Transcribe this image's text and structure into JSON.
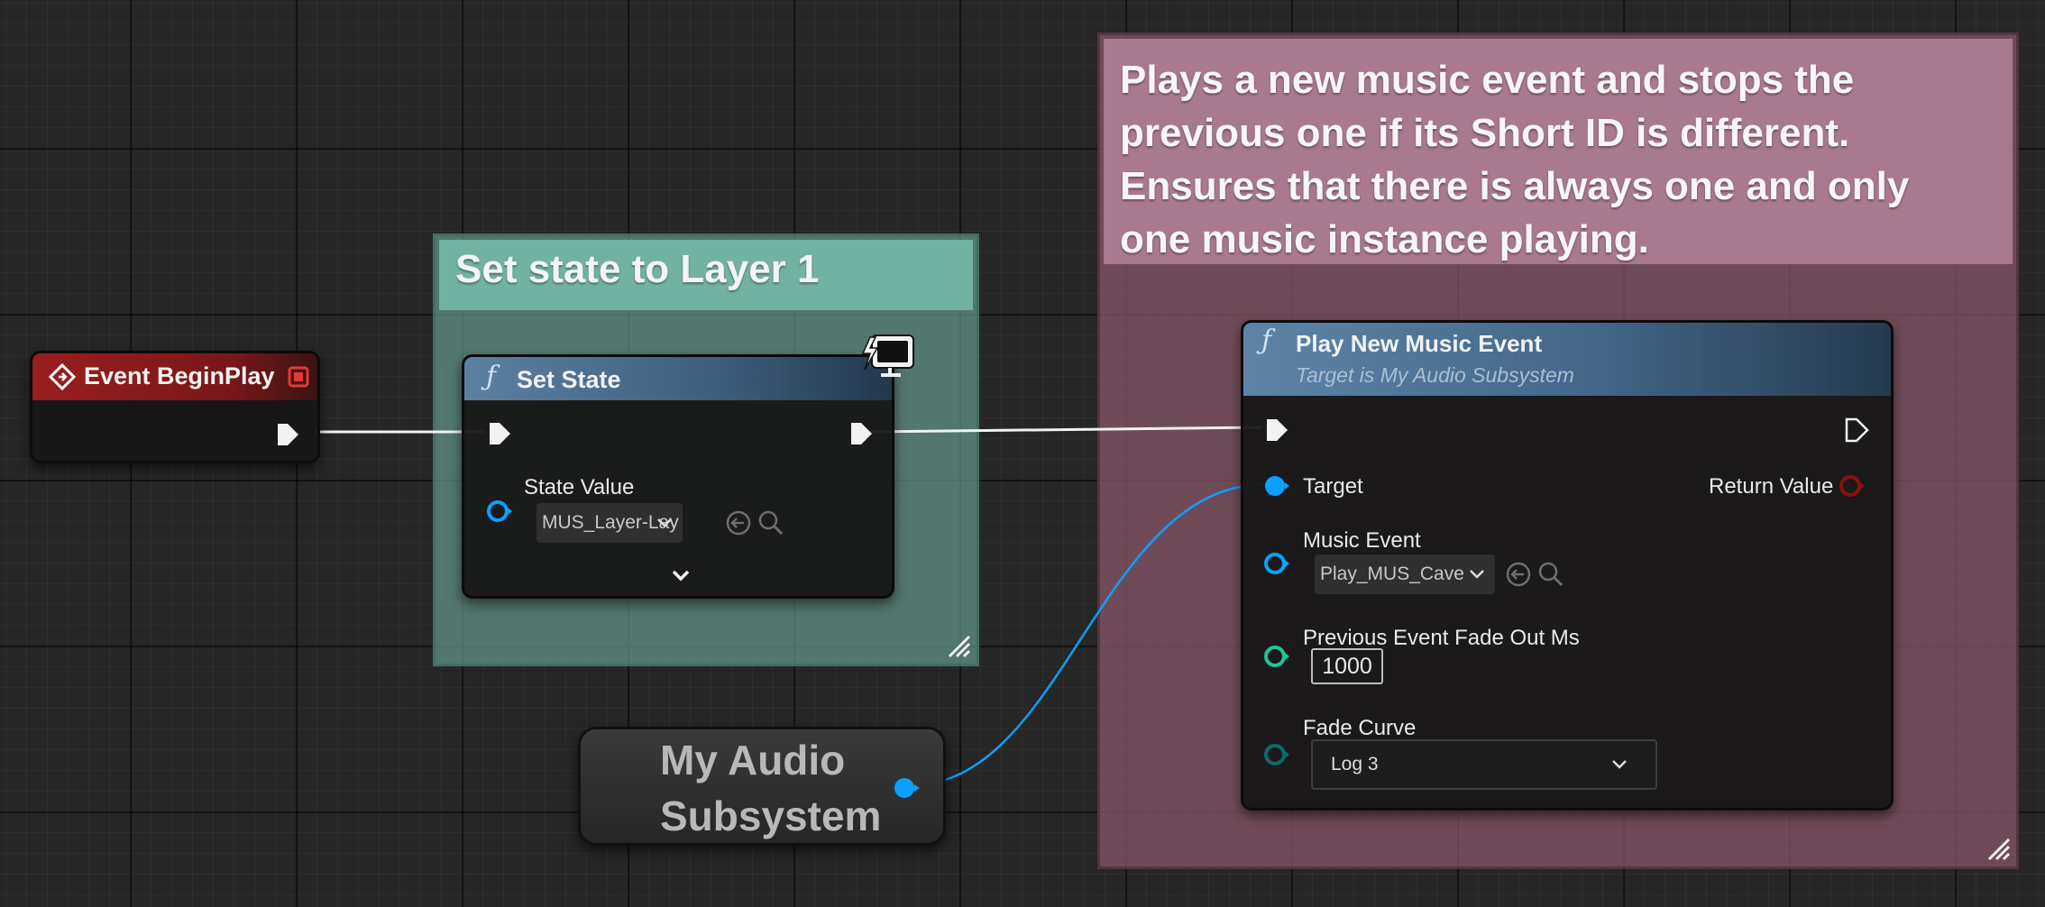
{
  "comments": {
    "set_state": "Set state to Layer 1",
    "play_music": {
      "line1": "Plays a new music event and stops the",
      "line2": "previous one if its Short ID is different.",
      "line3": "Ensures that there is always one and only",
      "line4": "one music instance playing."
    }
  },
  "event_begin_play": {
    "title": "Event BeginPlay"
  },
  "set_state": {
    "title": "Set State",
    "state_value_label": "State Value",
    "state_value": "MUS_Layer-Lay"
  },
  "play_new_music_event": {
    "title": "Play New Music Event",
    "subtitle": "Target is My Audio Subsystem",
    "target_label": "Target",
    "return_value_label": "Return Value",
    "music_event_label": "Music Event",
    "music_event_value": "Play_MUS_Cave",
    "fade_out_label": "Previous Event Fade Out Ms",
    "fade_out_value": "1000",
    "fade_curve_label": "Fade Curve",
    "fade_curve_value": "Log 3"
  },
  "audio_subsystem_node": {
    "line1": "My Audio",
    "line2": "Subsystem"
  },
  "colors": {
    "exec_wire": "#ffffff",
    "object_pin": "#0aa0ff",
    "event_header": "#8a1c1c",
    "function_header": "#4f7596",
    "teal_comment": "#72b2a3",
    "pink_comment": "#a8798f",
    "int_pin": "#1fc49a",
    "byte_pin": "#0a6b6b",
    "return_pin": "#8a1010"
  },
  "icons": [
    "event-diamond-icon",
    "stop-square-icon",
    "function-icon",
    "exec-pin-icon",
    "object-pin-icon",
    "browse-arrow-icon",
    "search-icon",
    "chevron-down-icon",
    "monitor-lightning-icon",
    "resize-grip-icon"
  ]
}
